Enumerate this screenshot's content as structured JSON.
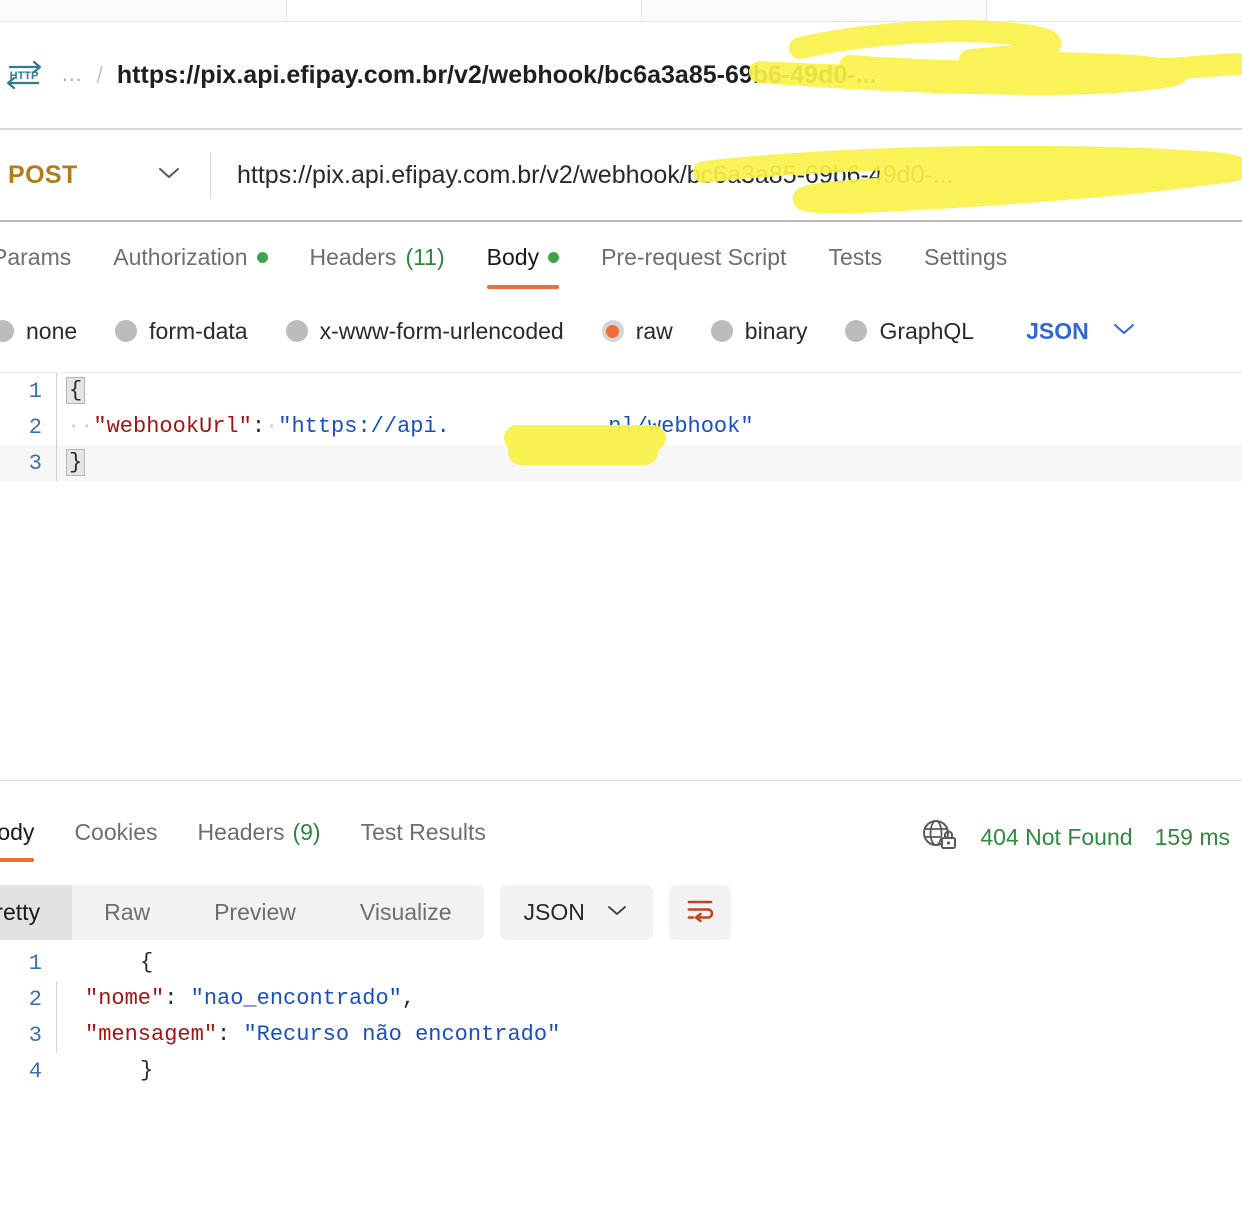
{
  "breadcrumb": {
    "protocol_icon": "http-badge-icon",
    "collapsed_label": "...",
    "separator": "/",
    "url": "https://pix.api.efipay.com.br/v2/webhook/bc6a3a85-69b6-49d0-..."
  },
  "request": {
    "method": "POST",
    "method_caret": "chevron-down-icon",
    "url": "https://pix.api.efipay.com.br/v2/webhook/bc6a3a85-69b6-49d0-...",
    "tabs": [
      {
        "label": "Params",
        "active": false,
        "dot": false,
        "count": ""
      },
      {
        "label": "Authorization",
        "active": false,
        "dot": true,
        "count": ""
      },
      {
        "label": "Headers",
        "active": false,
        "dot": false,
        "count": "(11)"
      },
      {
        "label": "Body",
        "active": true,
        "dot": true,
        "count": ""
      },
      {
        "label": "Pre-request Script",
        "active": false,
        "dot": false,
        "count": ""
      },
      {
        "label": "Tests",
        "active": false,
        "dot": false,
        "count": ""
      },
      {
        "label": "Settings",
        "active": false,
        "dot": false,
        "count": ""
      }
    ],
    "body_types": [
      {
        "label": "none",
        "selected": false
      },
      {
        "label": "form-data",
        "selected": false
      },
      {
        "label": "x-www-form-urlencoded",
        "selected": false
      },
      {
        "label": "raw",
        "selected": true
      },
      {
        "label": "binary",
        "selected": false
      },
      {
        "label": "GraphQL",
        "selected": false
      }
    ],
    "raw_format": "JSON",
    "body_lines": [
      {
        "number": "1",
        "text": "{"
      },
      {
        "number": "2",
        "text": "  \"webhookUrl\": \"https://api.          nl/webhook\""
      },
      {
        "number": "3",
        "text": "}"
      }
    ]
  },
  "response": {
    "tabs": [
      {
        "label": "Body",
        "active": true,
        "count": ""
      },
      {
        "label": "Cookies",
        "active": false,
        "count": ""
      },
      {
        "label": "Headers",
        "active": false,
        "count": "(9)"
      },
      {
        "label": "Test Results",
        "active": false,
        "count": ""
      }
    ],
    "security_icon": "globe-lock-icon",
    "status": "404 Not Found",
    "time": "159 ms",
    "view_modes": [
      {
        "label": "Pretty",
        "active": true
      },
      {
        "label": "Raw",
        "active": false
      },
      {
        "label": "Preview",
        "active": false
      },
      {
        "label": "Visualize",
        "active": false
      }
    ],
    "format": "JSON",
    "wrap_icon": "word-wrap-icon",
    "body_lines": [
      {
        "number": "1",
        "text": "{"
      },
      {
        "number": "2",
        "text": "    \"nome\": \"nao_encontrado\","
      },
      {
        "number": "3",
        "text": "    \"mensagem\": \"Recurso não encontrado\""
      },
      {
        "number": "4",
        "text": "}"
      }
    ]
  },
  "annotations": {
    "highlighter_color": "#f9f24a",
    "marks": [
      "breadcrumb-url-redaction",
      "url-bar-redaction",
      "webhook-url-redaction"
    ]
  },
  "colors": {
    "method": "#b07d18",
    "accent": "#ef6c3b",
    "success": "#2f8a3e",
    "link": "#3367d6",
    "json_key": "#a31515",
    "json_string": "#1a4fbd"
  }
}
